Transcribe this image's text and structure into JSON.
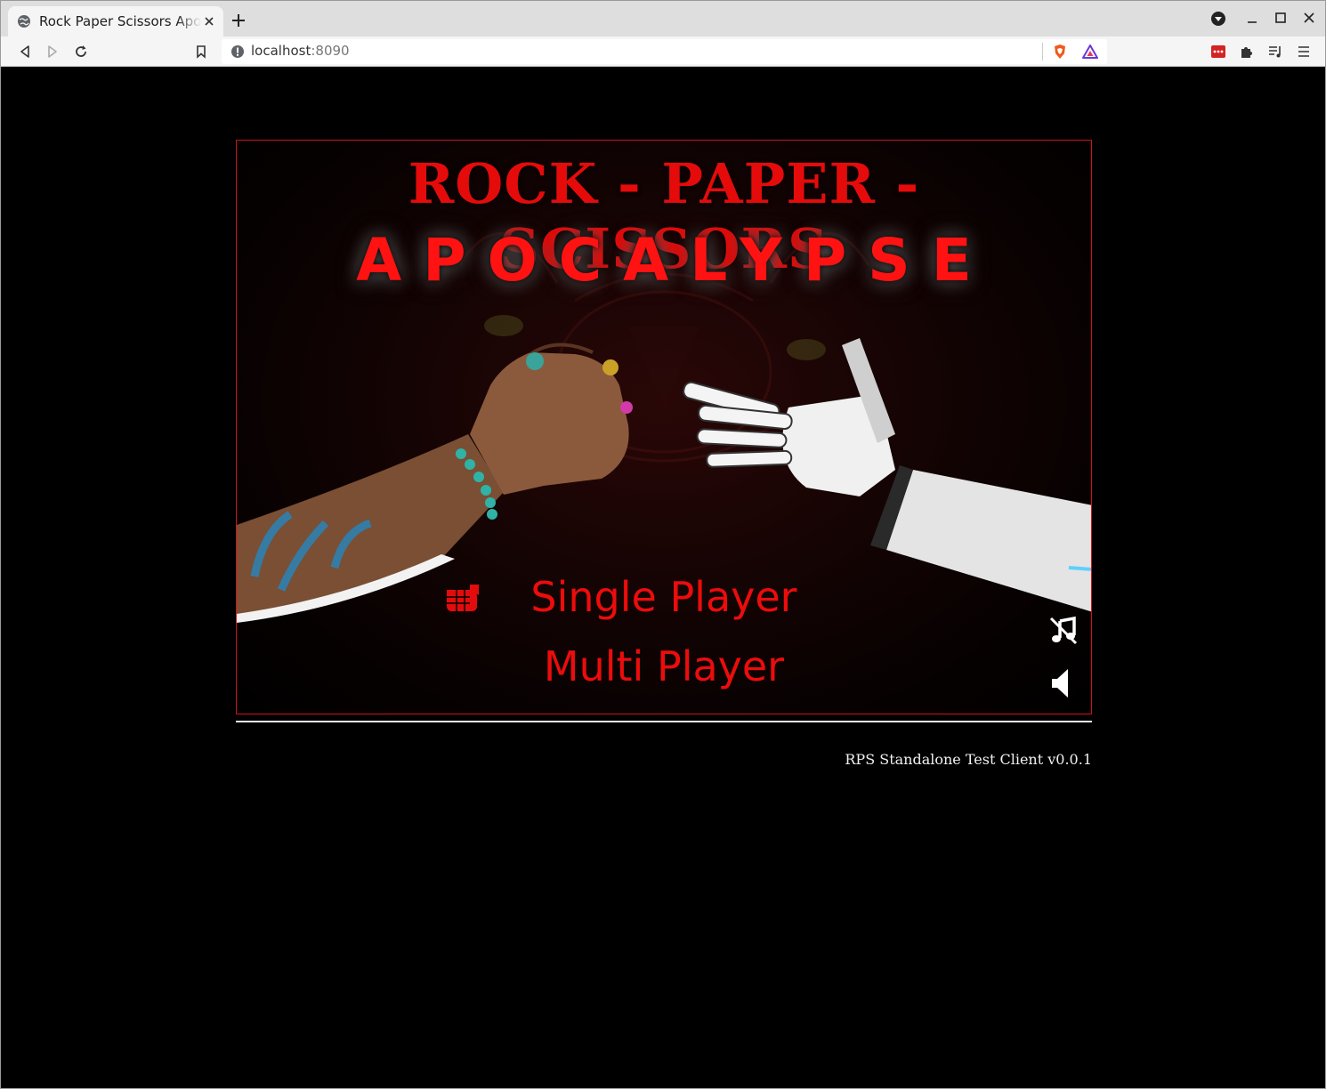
{
  "browser": {
    "tab_title": "Rock Paper Scissors Apocalypse",
    "url_host": "localhost",
    "url_port": ":8090"
  },
  "game": {
    "title_line1": "ROCK - PAPER - SCISSORS",
    "title_line2": "APOCALYPSE",
    "menu": {
      "single_player": "Single Player",
      "multi_player": "Multi Player"
    },
    "colors": {
      "accent": "#e50b0b",
      "border": "#d1121b"
    }
  },
  "footer": {
    "version_text": "RPS Standalone Test Client v0.0.1"
  }
}
